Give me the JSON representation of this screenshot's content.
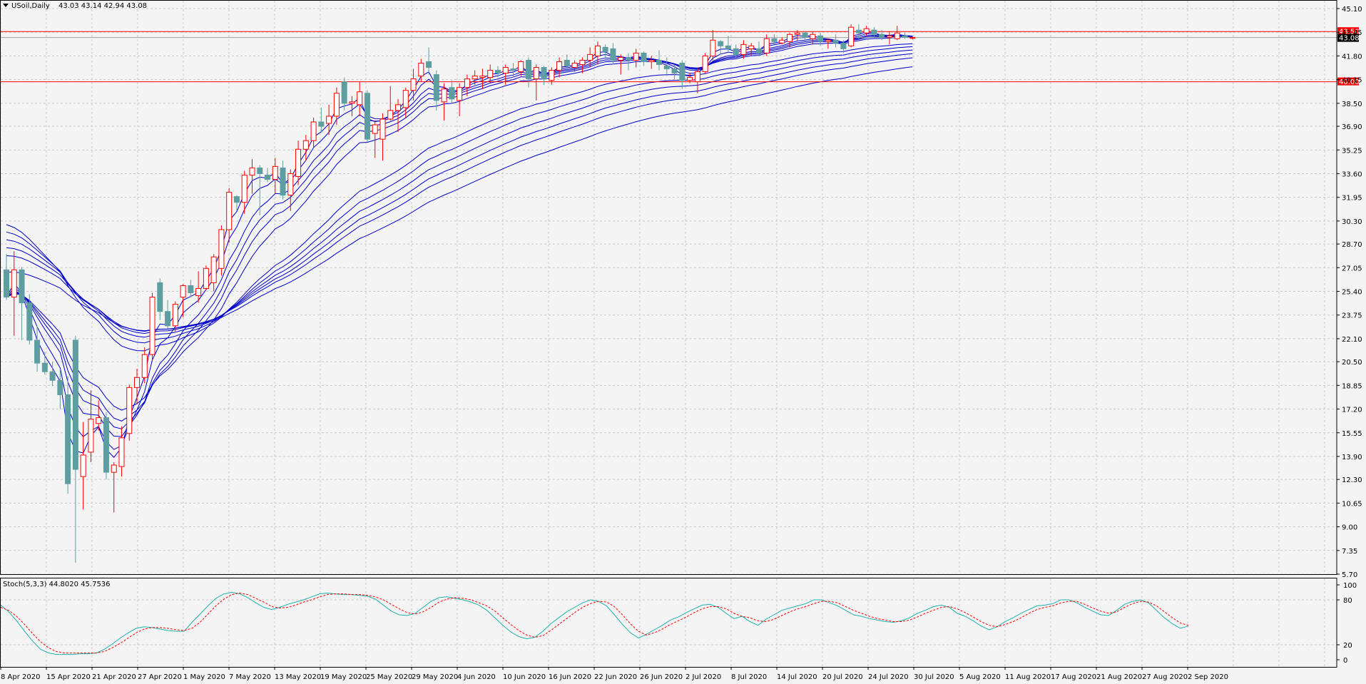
{
  "window": {
    "symbol_label": "USoil,Daily",
    "ohlc_label": "43.03 43.14 42.94 43.08"
  },
  "colors": {
    "background": "#f4f4f4",
    "grid": "#c8c8c8",
    "bull_candle": "#ff0000",
    "bear_candle": "#5f9ea0",
    "ma_lines": "#0000c8",
    "level_lines": "#ff0000",
    "stoch_main": "#20b2aa",
    "stoch_signal": "#ff0000"
  },
  "chart_data": [
    {
      "type": "candlestick",
      "symbol": "USoil",
      "timeframe": "Daily",
      "ylim": [
        5.7,
        45.1
      ],
      "y_ticks": [
        "45.10",
        "43.45",
        "41.80",
        "40.15",
        "38.50",
        "36.90",
        "35.25",
        "33.60",
        "31.95",
        "30.30",
        "28.70",
        "27.05",
        "25.40",
        "23.75",
        "22.10",
        "20.50",
        "18.85",
        "17.20",
        "15.55",
        "13.90",
        "12.30",
        "10.65",
        "9.00",
        "7.35",
        "5.70"
      ],
      "x_tick_labels": [
        "8 Apr 2020",
        "15 Apr 2020",
        "21 Apr 2020",
        "27 Apr 2020",
        "1 May 2020",
        "7 May 2020",
        "13 May 2020",
        "19 May 2020",
        "25 May 2020",
        "29 May 2020",
        "4 Jun 2020",
        "10 Jun 2020",
        "16 Jun 2020",
        "22 Jun 2020",
        "26 Jun 2020",
        "2 Jul 2020",
        "8 Jul 2020",
        "14 Jul 2020",
        "20 Jul 2020",
        "24 Jul 2020",
        "30 Jul 2020",
        "5 Aug 2020",
        "11 Aug 2020",
        "17 Aug 2020",
        "21 Aug 2020",
        "27 Aug 2020",
        "2 Sep 2020"
      ],
      "horizontal_levels": [
        {
          "value": 43.5,
          "label": "43.50"
        },
        {
          "value": 40.0,
          "label": "40.00"
        }
      ],
      "current_price": {
        "value": 43.08,
        "label": "43.08"
      },
      "candles": [
        {
          "o": 26.9,
          "h": 28.0,
          "l": 24.8,
          "c": 25.0
        },
        {
          "o": 25.0,
          "h": 28.2,
          "l": 22.3,
          "c": 26.9
        },
        {
          "o": 26.9,
          "h": 27.1,
          "l": 22.0,
          "c": 24.6
        },
        {
          "o": 24.6,
          "h": 25.2,
          "l": 21.7,
          "c": 22.0
        },
        {
          "o": 22.0,
          "h": 23.0,
          "l": 19.8,
          "c": 20.4
        },
        {
          "o": 20.4,
          "h": 21.2,
          "l": 19.6,
          "c": 19.8
        },
        {
          "o": 19.8,
          "h": 20.5,
          "l": 18.8,
          "c": 19.2
        },
        {
          "o": 19.2,
          "h": 20.0,
          "l": 17.2,
          "c": 18.2
        },
        {
          "o": 18.2,
          "h": 19.5,
          "l": 11.3,
          "c": 12.0
        },
        {
          "o": 22.0,
          "h": 22.3,
          "l": 6.5,
          "c": 13.0
        },
        {
          "o": 12.5,
          "h": 16.3,
          "l": 10.2,
          "c": 14.0
        },
        {
          "o": 14.2,
          "h": 18.5,
          "l": 13.5,
          "c": 16.5
        },
        {
          "o": 16.2,
          "h": 17.8,
          "l": 15.7,
          "c": 16.6
        },
        {
          "o": 16.6,
          "h": 17.0,
          "l": 12.3,
          "c": 12.8
        },
        {
          "o": 12.8,
          "h": 13.5,
          "l": 10.0,
          "c": 13.3
        },
        {
          "o": 13.2,
          "h": 16.0,
          "l": 12.5,
          "c": 15.2
        },
        {
          "o": 15.5,
          "h": 18.9,
          "l": 15.0,
          "c": 18.7
        },
        {
          "o": 18.7,
          "h": 20.0,
          "l": 17.6,
          "c": 19.4
        },
        {
          "o": 19.4,
          "h": 21.5,
          "l": 19.0,
          "c": 21.0
        },
        {
          "o": 21.0,
          "h": 25.3,
          "l": 20.5,
          "c": 25.0
        },
        {
          "o": 26.0,
          "h": 26.3,
          "l": 23.4,
          "c": 24.0
        },
        {
          "o": 24.0,
          "h": 24.8,
          "l": 22.8,
          "c": 23.0
        },
        {
          "o": 23.0,
          "h": 24.7,
          "l": 22.6,
          "c": 24.5
        },
        {
          "o": 25.0,
          "h": 25.9,
          "l": 23.6,
          "c": 25.8
        },
        {
          "o": 25.8,
          "h": 26.2,
          "l": 25.0,
          "c": 25.3
        },
        {
          "o": 25.1,
          "h": 26.8,
          "l": 24.6,
          "c": 25.6
        },
        {
          "o": 25.6,
          "h": 27.2,
          "l": 25.5,
          "c": 27.0
        },
        {
          "o": 26.0,
          "h": 28.0,
          "l": 25.4,
          "c": 27.8
        },
        {
          "o": 27.0,
          "h": 30.0,
          "l": 26.5,
          "c": 29.7
        },
        {
          "o": 29.7,
          "h": 32.6,
          "l": 28.8,
          "c": 32.3
        },
        {
          "o": 32.0,
          "h": 32.1,
          "l": 31.0,
          "c": 31.6
        },
        {
          "o": 31.6,
          "h": 33.8,
          "l": 30.8,
          "c": 33.5
        },
        {
          "o": 33.5,
          "h": 34.6,
          "l": 32.2,
          "c": 34.0
        },
        {
          "o": 34.0,
          "h": 34.2,
          "l": 30.7,
          "c": 33.6
        },
        {
          "o": 33.5,
          "h": 34.0,
          "l": 33.0,
          "c": 33.2
        },
        {
          "o": 33.2,
          "h": 34.7,
          "l": 32.2,
          "c": 34.1
        },
        {
          "o": 34.0,
          "h": 34.5,
          "l": 31.8,
          "c": 32.1
        },
        {
          "o": 32.1,
          "h": 33.9,
          "l": 31.0,
          "c": 33.6
        },
        {
          "o": 33.4,
          "h": 35.9,
          "l": 32.8,
          "c": 35.3
        },
        {
          "o": 35.3,
          "h": 36.3,
          "l": 34.5,
          "c": 35.9
        },
        {
          "o": 35.9,
          "h": 37.5,
          "l": 35.4,
          "c": 37.2
        },
        {
          "o": 37.2,
          "h": 38.2,
          "l": 36.5,
          "c": 36.9
        },
        {
          "o": 37.1,
          "h": 38.4,
          "l": 36.3,
          "c": 37.6
        },
        {
          "o": 37.6,
          "h": 39.6,
          "l": 37.0,
          "c": 39.2
        },
        {
          "o": 40.0,
          "h": 40.3,
          "l": 38.0,
          "c": 38.5
        },
        {
          "o": 38.5,
          "h": 39.0,
          "l": 37.6,
          "c": 38.6
        },
        {
          "o": 38.4,
          "h": 40.0,
          "l": 37.6,
          "c": 39.3
        },
        {
          "o": 39.2,
          "h": 39.4,
          "l": 35.8,
          "c": 36.0
        },
        {
          "o": 36.4,
          "h": 37.3,
          "l": 34.7,
          "c": 37.0
        },
        {
          "o": 36.0,
          "h": 37.8,
          "l": 34.5,
          "c": 37.4
        },
        {
          "o": 37.4,
          "h": 39.7,
          "l": 37.3,
          "c": 38.0
        },
        {
          "o": 38.0,
          "h": 38.8,
          "l": 36.5,
          "c": 38.4
        },
        {
          "o": 38.2,
          "h": 39.6,
          "l": 37.5,
          "c": 39.4
        },
        {
          "o": 39.4,
          "h": 40.9,
          "l": 38.7,
          "c": 40.2
        },
        {
          "o": 40.4,
          "h": 41.6,
          "l": 40.0,
          "c": 41.3
        },
        {
          "o": 41.4,
          "h": 42.4,
          "l": 40.5,
          "c": 41.0
        },
        {
          "o": 40.5,
          "h": 40.8,
          "l": 38.0,
          "c": 38.7
        },
        {
          "o": 38.6,
          "h": 39.9,
          "l": 37.3,
          "c": 39.5
        },
        {
          "o": 39.6,
          "h": 40.1,
          "l": 38.5,
          "c": 38.8
        },
        {
          "o": 38.7,
          "h": 39.9,
          "l": 37.6,
          "c": 39.6
        },
        {
          "o": 39.6,
          "h": 40.5,
          "l": 39.0,
          "c": 40.2
        },
        {
          "o": 40.2,
          "h": 40.8,
          "l": 39.8,
          "c": 40.4
        },
        {
          "o": 40.3,
          "h": 40.9,
          "l": 39.5,
          "c": 40.4
        },
        {
          "o": 40.3,
          "h": 41.2,
          "l": 39.9,
          "c": 40.8
        },
        {
          "o": 40.8,
          "h": 41.1,
          "l": 40.3,
          "c": 40.6
        },
        {
          "o": 40.6,
          "h": 41.2,
          "l": 39.8,
          "c": 41.0
        },
        {
          "o": 40.9,
          "h": 41.3,
          "l": 40.3,
          "c": 40.8
        },
        {
          "o": 40.7,
          "h": 41.5,
          "l": 40.4,
          "c": 41.4
        },
        {
          "o": 41.5,
          "h": 41.7,
          "l": 39.6,
          "c": 40.2
        },
        {
          "o": 40.2,
          "h": 41.2,
          "l": 38.7,
          "c": 41.0
        },
        {
          "o": 41.0,
          "h": 41.1,
          "l": 39.8,
          "c": 40.2
        },
        {
          "o": 40.1,
          "h": 41.0,
          "l": 39.8,
          "c": 40.8
        },
        {
          "o": 40.8,
          "h": 41.7,
          "l": 40.3,
          "c": 41.4
        },
        {
          "o": 41.5,
          "h": 41.9,
          "l": 40.8,
          "c": 41.1
        },
        {
          "o": 41.0,
          "h": 41.5,
          "l": 40.7,
          "c": 41.3
        },
        {
          "o": 41.2,
          "h": 41.7,
          "l": 40.6,
          "c": 41.5
        },
        {
          "o": 41.5,
          "h": 42.4,
          "l": 41.0,
          "c": 41.9
        },
        {
          "o": 41.8,
          "h": 42.8,
          "l": 41.2,
          "c": 42.5
        },
        {
          "o": 42.4,
          "h": 42.6,
          "l": 41.6,
          "c": 42.1
        },
        {
          "o": 42.3,
          "h": 42.7,
          "l": 41.2,
          "c": 41.5
        },
        {
          "o": 41.5,
          "h": 41.9,
          "l": 40.5,
          "c": 41.7
        },
        {
          "o": 41.7,
          "h": 42.0,
          "l": 40.8,
          "c": 41.5
        },
        {
          "o": 41.5,
          "h": 42.3,
          "l": 41.0,
          "c": 42.0
        },
        {
          "o": 42.0,
          "h": 42.1,
          "l": 41.1,
          "c": 41.4
        },
        {
          "o": 41.4,
          "h": 41.8,
          "l": 40.9,
          "c": 41.5
        },
        {
          "o": 41.5,
          "h": 42.2,
          "l": 40.8,
          "c": 41.2
        },
        {
          "o": 41.1,
          "h": 41.7,
          "l": 40.4,
          "c": 40.9
        },
        {
          "o": 40.9,
          "h": 41.2,
          "l": 40.2,
          "c": 40.6
        },
        {
          "o": 41.3,
          "h": 41.5,
          "l": 39.5,
          "c": 40.1
        },
        {
          "o": 40.1,
          "h": 40.6,
          "l": 39.9,
          "c": 40.3
        },
        {
          "o": 40.0,
          "h": 41.0,
          "l": 39.2,
          "c": 40.7
        },
        {
          "o": 40.7,
          "h": 42.0,
          "l": 40.6,
          "c": 41.8
        },
        {
          "o": 41.8,
          "h": 43.6,
          "l": 41.5,
          "c": 42.9
        },
        {
          "o": 42.8,
          "h": 42.9,
          "l": 41.9,
          "c": 42.5
        },
        {
          "o": 42.5,
          "h": 43.2,
          "l": 42.0,
          "c": 42.3
        },
        {
          "o": 42.3,
          "h": 42.6,
          "l": 41.6,
          "c": 41.9
        },
        {
          "o": 41.9,
          "h": 42.9,
          "l": 41.6,
          "c": 42.6
        },
        {
          "o": 42.3,
          "h": 42.7,
          "l": 41.8,
          "c": 42.5
        },
        {
          "o": 42.3,
          "h": 42.8,
          "l": 41.8,
          "c": 42.0
        },
        {
          "o": 42.0,
          "h": 43.3,
          "l": 41.8,
          "c": 43.0
        },
        {
          "o": 43.0,
          "h": 43.3,
          "l": 42.6,
          "c": 42.8
        },
        {
          "o": 42.7,
          "h": 43.1,
          "l": 42.6,
          "c": 42.9
        },
        {
          "o": 42.8,
          "h": 43.4,
          "l": 42.4,
          "c": 43.3
        },
        {
          "o": 43.3,
          "h": 43.6,
          "l": 42.9,
          "c": 43.4
        },
        {
          "o": 43.4,
          "h": 43.5,
          "l": 42.8,
          "c": 43.1
        },
        {
          "o": 43.0,
          "h": 43.5,
          "l": 42.6,
          "c": 43.3
        },
        {
          "o": 43.2,
          "h": 43.4,
          "l": 42.5,
          "c": 42.8
        },
        {
          "o": 42.8,
          "h": 43.0,
          "l": 42.3,
          "c": 42.9
        },
        {
          "o": 42.9,
          "h": 43.3,
          "l": 42.4,
          "c": 42.7
        },
        {
          "o": 42.7,
          "h": 42.9,
          "l": 42.0,
          "c": 42.3
        },
        {
          "o": 42.5,
          "h": 44.0,
          "l": 42.4,
          "c": 43.8
        },
        {
          "o": 43.6,
          "h": 44.0,
          "l": 43.0,
          "c": 43.4
        },
        {
          "o": 43.4,
          "h": 43.9,
          "l": 43.2,
          "c": 43.7
        },
        {
          "o": 43.6,
          "h": 43.8,
          "l": 43.0,
          "c": 43.3
        },
        {
          "o": 43.3,
          "h": 43.6,
          "l": 42.9,
          "c": 43.1
        },
        {
          "o": 43.1,
          "h": 43.5,
          "l": 42.6,
          "c": 43.2
        },
        {
          "o": 43.0,
          "h": 43.9,
          "l": 42.9,
          "c": 43.4
        },
        {
          "o": 43.2,
          "h": 43.4,
          "l": 43.0,
          "c": 43.1
        },
        {
          "o": 43.03,
          "h": 43.14,
          "l": 42.94,
          "c": 43.08
        }
      ],
      "moving_averages": {
        "description": "Guppy-style ribbon: short and long EMAs of close",
        "periods": [
          3,
          5,
          8,
          10,
          12,
          15,
          30,
          35,
          40,
          45,
          50,
          60
        ]
      }
    },
    {
      "type": "line",
      "indicator_label": "Stoch(5,3,3) 44.8020 45.7536",
      "ylim": [
        0,
        100
      ],
      "y_ticks": [
        "100",
        "80",
        "20",
        "0"
      ],
      "series": [
        {
          "name": "",
          "values": [
            73,
            64,
            52,
            38,
            25,
            14,
            9,
            7,
            7,
            7,
            8,
            8,
            9,
            14,
            21,
            29,
            36,
            42,
            44,
            43,
            41,
            39,
            38,
            38,
            50,
            61,
            72,
            82,
            88,
            90,
            88,
            83,
            76,
            70,
            67,
            70,
            74,
            77,
            80,
            84,
            88,
            89,
            88,
            87,
            87,
            86,
            85,
            81,
            73,
            65,
            60,
            59,
            62,
            70,
            78,
            83,
            84,
            82,
            80,
            77,
            73,
            66,
            56,
            46,
            37,
            31,
            28,
            30,
            38,
            48,
            56,
            64,
            70,
            76,
            80,
            78,
            72,
            60,
            47,
            36,
            29,
            34,
            40,
            46,
            53,
            57,
            63,
            68,
            73,
            74,
            70,
            62,
            55,
            58,
            51,
            46,
            54,
            60,
            66,
            69,
            72,
            75,
            80,
            80,
            76,
            72,
            66,
            60,
            58,
            55,
            53,
            51,
            50,
            52,
            56,
            62,
            66,
            71,
            73,
            70,
            62,
            58,
            52,
            45,
            40,
            44,
            51,
            56,
            62,
            67,
            72,
            73,
            75,
            80,
            80,
            76,
            70,
            65,
            60,
            59,
            66,
            74,
            78,
            80,
            76,
            66,
            56,
            48,
            42,
            45
          ]
        },
        {
          "name": "",
          "values": [
            70,
            66,
            58,
            47,
            35,
            24,
            16,
            11,
            9,
            9,
            9,
            9,
            9,
            11,
            16,
            22,
            29,
            36,
            41,
            43,
            43,
            42,
            40,
            39,
            42,
            50,
            61,
            72,
            81,
            87,
            89,
            87,
            82,
            77,
            71,
            69,
            70,
            73,
            77,
            80,
            84,
            87,
            88,
            88,
            87,
            87,
            86,
            84,
            80,
            74,
            68,
            63,
            61,
            64,
            70,
            77,
            81,
            83,
            82,
            80,
            76,
            72,
            65,
            56,
            47,
            39,
            33,
            30,
            32,
            39,
            47,
            55,
            63,
            70,
            75,
            78,
            77,
            71,
            60,
            48,
            38,
            33,
            36,
            41,
            47,
            52,
            57,
            63,
            68,
            71,
            71,
            68,
            62,
            58,
            56,
            52,
            51,
            54,
            59,
            64,
            68,
            71,
            75,
            78,
            78,
            76,
            71,
            66,
            62,
            58,
            55,
            53,
            51,
            51,
            53,
            57,
            62,
            66,
            70,
            71,
            68,
            63,
            57,
            51,
            46,
            44,
            47,
            51,
            56,
            62,
            67,
            70,
            72,
            76,
            78,
            78,
            74,
            69,
            65,
            62,
            64,
            70,
            75,
            78,
            77,
            72,
            64,
            56,
            49,
            46
          ]
        }
      ]
    }
  ]
}
